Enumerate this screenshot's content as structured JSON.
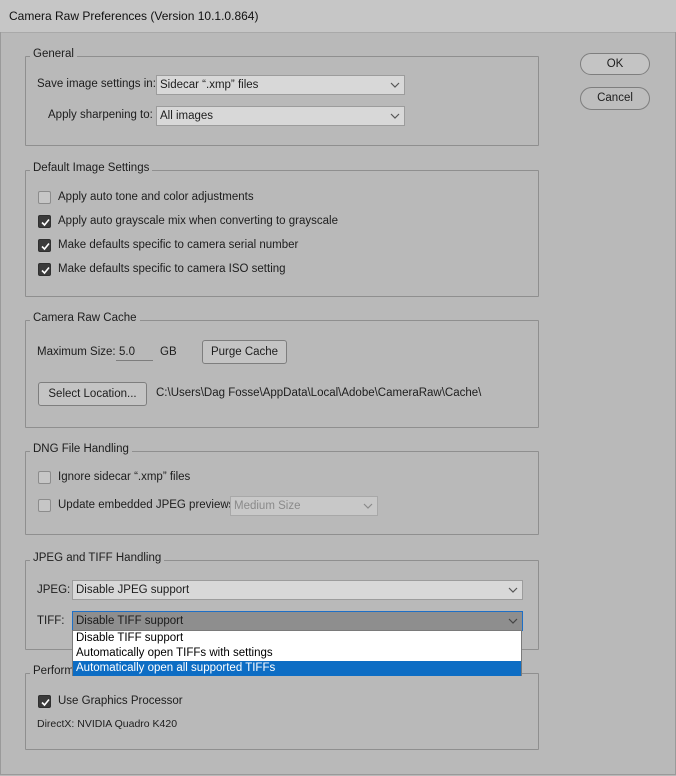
{
  "window": {
    "title": "Camera Raw Preferences  (Version 10.1.0.864)"
  },
  "buttons": {
    "ok": "OK",
    "cancel": "Cancel"
  },
  "general": {
    "title": "General",
    "save_settings_label": "Save image settings in:",
    "save_settings_value": "Sidecar “.xmp” files",
    "sharpening_label": "Apply sharpening to:",
    "sharpening_value": "All images"
  },
  "default_image": {
    "title": "Default Image Settings",
    "options": [
      {
        "label": "Apply auto tone and color adjustments",
        "checked": false
      },
      {
        "label": "Apply auto grayscale mix when converting to grayscale",
        "checked": true
      },
      {
        "label": "Make defaults specific to camera serial number",
        "checked": true
      },
      {
        "label": "Make defaults specific to camera ISO setting",
        "checked": true
      }
    ]
  },
  "cache": {
    "title": "Camera Raw Cache",
    "max_size_label": "Maximum Size:",
    "max_size_value": "5.0",
    "unit": "GB",
    "purge_button": "Purge Cache",
    "select_location_button": "Select Location...",
    "path": "C:\\Users\\Dag Fosse\\AppData\\Local\\Adobe\\CameraRaw\\Cache\\"
  },
  "dng": {
    "title": "DNG File Handling",
    "ignore_sidecar_label": "Ignore sidecar “.xmp” files",
    "ignore_sidecar_checked": false,
    "update_previews_label": "Update embedded JPEG previews:",
    "update_previews_checked": false,
    "preview_size_value": "Medium Size"
  },
  "jpeg_tiff": {
    "title": "JPEG and TIFF Handling",
    "jpeg_label": "JPEG:",
    "jpeg_value": "Disable JPEG support",
    "tiff_label": "TIFF:",
    "tiff_value": "Disable TIFF support",
    "tiff_options": [
      "Disable TIFF support",
      "Automatically open TIFFs with settings",
      "Automatically open all supported TIFFs"
    ],
    "tiff_highlighted_option": "Automatically open all supported TIFFs"
  },
  "performance": {
    "title": "Performance",
    "gpu_label": "Use Graphics Processor",
    "gpu_checked": true,
    "gpu_info": "DirectX: NVIDIA Quadro K420"
  },
  "colors": {
    "background": "#b9b9b9",
    "highlight": "#0d6dc4",
    "checkbox_checked": "#3b3b3b"
  }
}
